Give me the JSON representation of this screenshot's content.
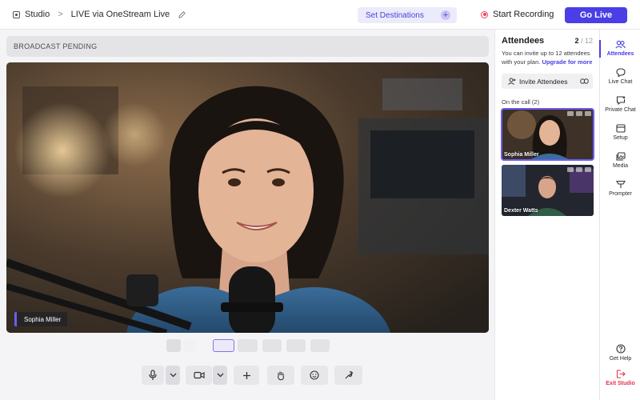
{
  "header": {
    "studio_label": "Studio",
    "stream_title": "LIVE via OneStream Live",
    "set_destinations": "Set Destinations",
    "start_recording": "Start Recording",
    "go_live": "Go Live"
  },
  "stage": {
    "banner": "BROADCAST PENDING",
    "speaker_name": "Sophia Miller"
  },
  "attendees": {
    "title": "Attendees",
    "count": "2",
    "max": "/ 12",
    "info": "You can invite up to 12 attendees with your plan.",
    "upgrade": "Upgrade for more",
    "invite_label": "Invite Attendees",
    "on_call_label": "On the call (2)",
    "participants": [
      {
        "name": "Sophia Miller"
      },
      {
        "name": "Dexter Watts"
      }
    ]
  },
  "rail": {
    "items": [
      {
        "label": "Attendees",
        "icon": "people-icon"
      },
      {
        "label": "Live Chat",
        "icon": "chat-bubble-icon"
      },
      {
        "label": "Private Chat",
        "icon": "private-chat-icon"
      },
      {
        "label": "Setup",
        "icon": "setup-icon"
      },
      {
        "label": "Media",
        "icon": "media-icon"
      },
      {
        "label": "Prompter",
        "icon": "prompter-icon"
      }
    ],
    "help": "Get Help",
    "exit": "Exit Studio"
  },
  "colors": {
    "accent": "#4a3ee6",
    "record": "#f0445a",
    "exit": "#e0354b"
  }
}
